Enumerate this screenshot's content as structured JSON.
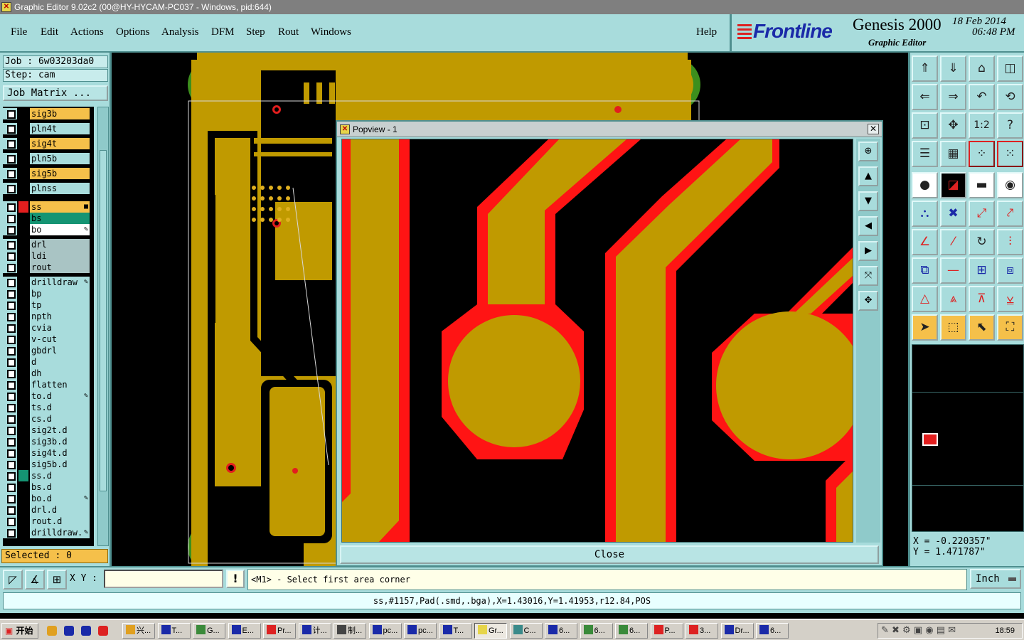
{
  "window": {
    "title": "Graphic Editor 9.02c2 (00@HY-HYCAM-PC037 - Windows, pid:644)"
  },
  "menu": [
    "File",
    "Edit",
    "Actions",
    "Options",
    "Analysis",
    "DFM",
    "Step",
    "Rout",
    "Windows"
  ],
  "help_label": "Help",
  "brand": {
    "logo": "Frontline",
    "product": "Genesis 2000",
    "date": "18 Feb 2014",
    "time": "06:48 PM",
    "subtitle": "Graphic Editor"
  },
  "job": {
    "job_line": "Job : 6w03203da0",
    "step_line": "Step: cam",
    "matrix_button": "Job Matrix ..."
  },
  "layers": [
    {
      "name": "sig3b",
      "style": "sel"
    },
    {
      "name": "pln4t",
      "style": "plain"
    },
    {
      "name": "sig4t",
      "style": "sel"
    },
    {
      "name": "pln5b",
      "style": "plain"
    },
    {
      "name": "sig5b",
      "style": "sel"
    },
    {
      "name": "plnss",
      "style": "plain"
    },
    {
      "name": "ss",
      "style": "orange",
      "mark": "#e21e1e",
      "flag": "■"
    },
    {
      "name": "bs",
      "style": "green"
    },
    {
      "name": "bo",
      "style": "white",
      "flag": "✎"
    },
    {
      "name": "drl",
      "style": "grey"
    },
    {
      "name": "ldi",
      "style": "grey"
    },
    {
      "name": "rout",
      "style": "grey"
    },
    {
      "name": "drilldraw",
      "style": "plain",
      "flag": "✎"
    },
    {
      "name": "bp",
      "style": "plain"
    },
    {
      "name": "tp",
      "style": "plain"
    },
    {
      "name": "npth",
      "style": "plain"
    },
    {
      "name": "cvia",
      "style": "plain"
    },
    {
      "name": "v-cut",
      "style": "plain"
    },
    {
      "name": "gbdrl",
      "style": "plain"
    },
    {
      "name": "d",
      "style": "plain"
    },
    {
      "name": "dh",
      "style": "plain"
    },
    {
      "name": "flatten",
      "style": "plain"
    },
    {
      "name": "to.d",
      "style": "plain",
      "flag": "✎"
    },
    {
      "name": "ts.d",
      "style": "plain"
    },
    {
      "name": "cs.d",
      "style": "plain"
    },
    {
      "name": "sig2t.d",
      "style": "plain"
    },
    {
      "name": "sig3b.d",
      "style": "plain"
    },
    {
      "name": "sig4t.d",
      "style": "plain"
    },
    {
      "name": "sig5b.d",
      "style": "plain"
    },
    {
      "name": "ss.d",
      "style": "plain",
      "mark": "#159473"
    },
    {
      "name": "bs.d",
      "style": "plain"
    },
    {
      "name": "bo.d",
      "style": "plain",
      "flag": "✎"
    },
    {
      "name": "drl.d",
      "style": "plain"
    },
    {
      "name": "rout.d",
      "style": "plain"
    },
    {
      "name": "drilldraw.",
      "style": "plain",
      "flag": "✎"
    }
  ],
  "selected": "Selected : 0",
  "popview": {
    "title": "Popview - 1",
    "close_label": "Close",
    "close_x": "✕"
  },
  "coords": {
    "x": "X  =  -0.220357\"",
    "y": "Y  =  1.471787\""
  },
  "command": {
    "xy_label": "X Y :",
    "xy_value": "",
    "excl": "!",
    "prompt": "<M1> - Select first area corner",
    "units": "Inch"
  },
  "status": "ss,#1157,Pad(.smd,.bga),X=1.43016,Y=1.41953,r12.84,POS",
  "taskbar": {
    "start": "开始",
    "clock": "18:59",
    "tasks": [
      "兴...",
      "T...",
      "G...",
      "E...",
      "Pr...",
      "计...",
      "制...",
      "pc...",
      "pc...",
      "T...",
      "Gr...",
      "C...",
      "6...",
      "6...",
      "6...",
      "P...",
      "3...",
      "Dr...",
      "6..."
    ]
  },
  "colors": {
    "panel": "#a8dcdc",
    "copper": "#c09a00",
    "red": "#ff1414",
    "orange": "#f5c04a",
    "green": "#159473"
  }
}
